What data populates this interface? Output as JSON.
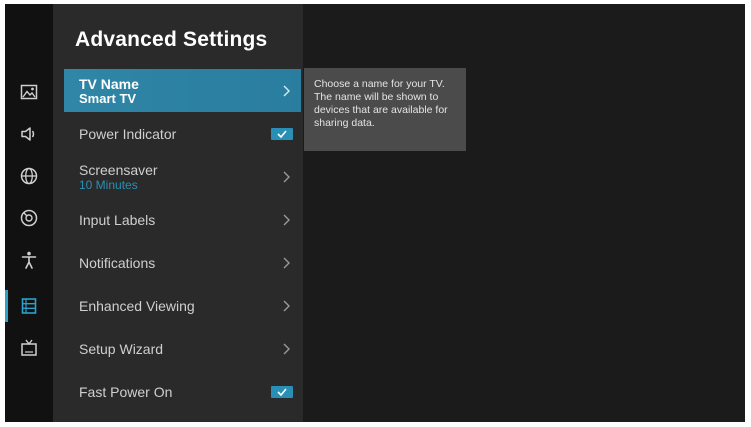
{
  "settings": {
    "title": "Advanced Settings",
    "items": [
      {
        "label": "TV Name",
        "sub": "Smart TV"
      },
      {
        "label": "Power Indicator"
      },
      {
        "label": "Screensaver",
        "sub": "10 Minutes"
      },
      {
        "label": "Input Labels"
      },
      {
        "label": "Notifications"
      },
      {
        "label": "Enhanced Viewing"
      },
      {
        "label": "Setup Wizard"
      },
      {
        "label": "Fast Power On"
      }
    ]
  },
  "tooltip": {
    "text": "Choose a name for your TV. The name will be shown to devices that are available for sharing data."
  },
  "rail": {
    "icons": [
      "picture-icon",
      "sound-icon",
      "network-icon",
      "general-icon",
      "accessibility-icon",
      "system-icon",
      "channel-icon"
    ],
    "active": "system-icon"
  },
  "colors": {
    "accent": "#2a8fb4",
    "selected": "#2f86a6",
    "panel": "#2a2a2a",
    "background": "#1b1b1b"
  }
}
